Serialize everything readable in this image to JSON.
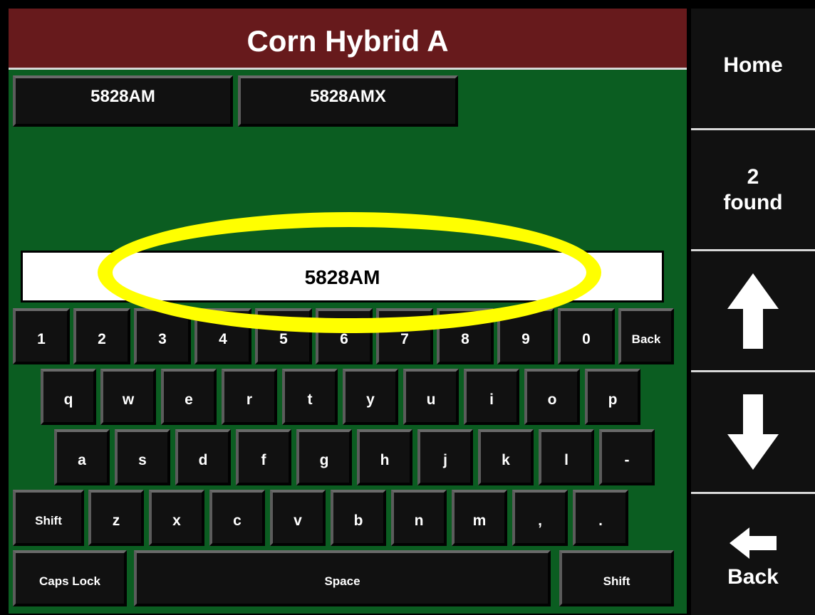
{
  "title": "Corn Hybrid A",
  "results": [
    "5828AM",
    "5828AMX"
  ],
  "entry_value": "5828AM",
  "keyboard": {
    "row_numbers": [
      "1",
      "2",
      "3",
      "4",
      "5",
      "6",
      "7",
      "8",
      "9",
      "0"
    ],
    "back_label": "Back",
    "row_top": [
      "q",
      "w",
      "e",
      "r",
      "t",
      "y",
      "u",
      "i",
      "o",
      "p"
    ],
    "row_home": [
      "a",
      "s",
      "d",
      "f",
      "g",
      "h",
      "j",
      "k",
      "l",
      "-"
    ],
    "shift_left_label": "Shift",
    "row_bottom": [
      "z",
      "x",
      "c",
      "v",
      "b",
      "n",
      "m",
      ",",
      "."
    ],
    "caps_lock_label": "Caps Lock",
    "space_label": "Space",
    "shift_right_label": "Shift"
  },
  "sidebar": {
    "home_label": "Home",
    "found_count": "2",
    "found_label": "found",
    "up_icon": "arrow-up-icon",
    "down_icon": "arrow-down-icon",
    "back_icon": "arrow-left-icon",
    "back_label": "Back"
  },
  "colors": {
    "title_bar": "#671a1c",
    "background": "#0b5d21",
    "key": "#111111",
    "highlight": "#ffff00"
  }
}
